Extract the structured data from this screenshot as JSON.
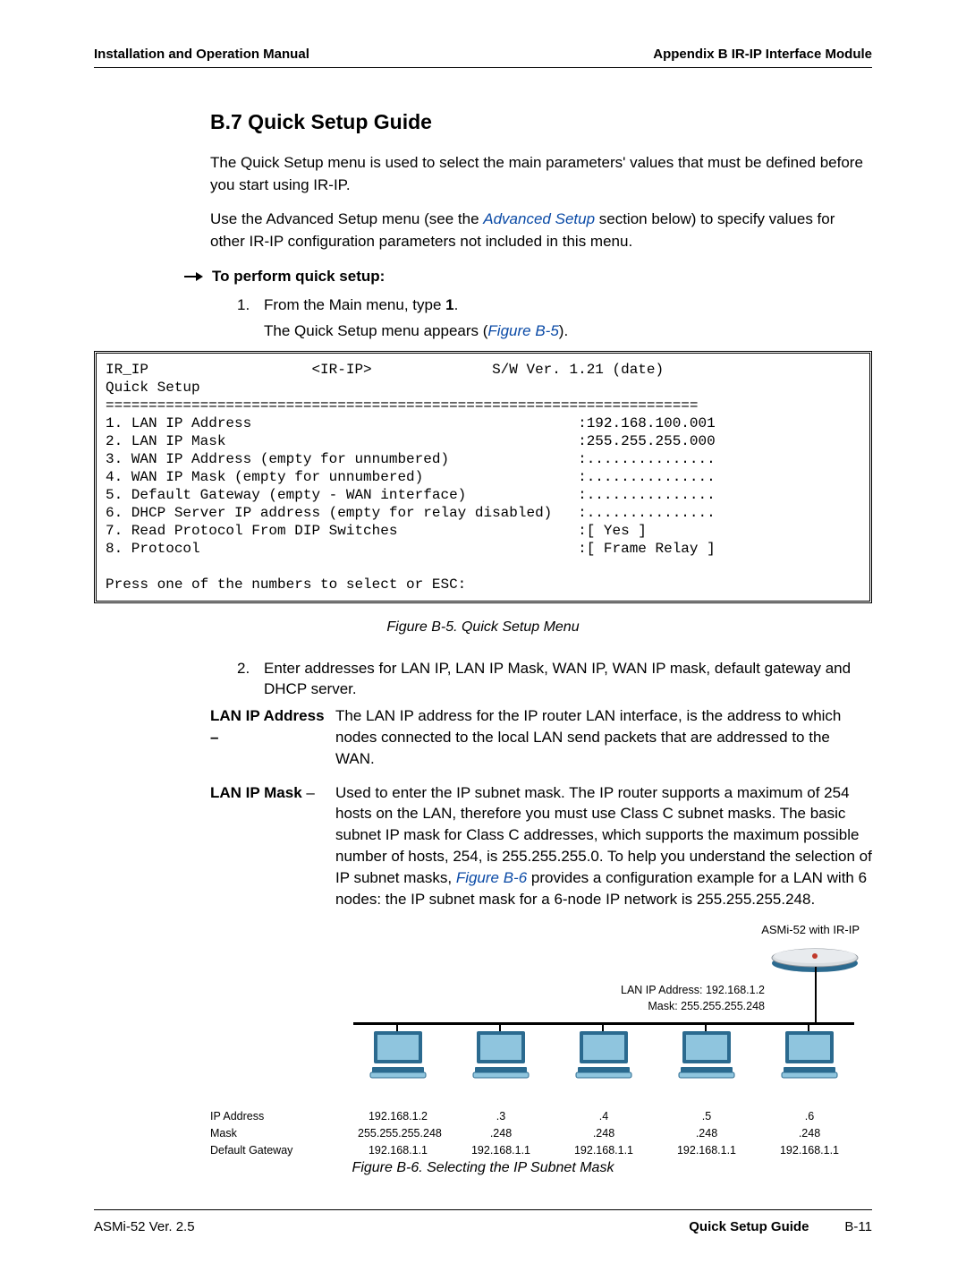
{
  "header": {
    "left": "Installation and Operation Manual",
    "right": "Appendix B  IR-IP Interface Module"
  },
  "section": {
    "title": "B.7  Quick Setup Guide",
    "p1": "The Quick Setup menu is used to select the main parameters' values that must be defined before you start using IR-IP.",
    "p2a": "Use the Advanced Setup menu (see the ",
    "p2link": "Advanced Setup",
    "p2b": " section below) to specify values for other IR-IP configuration parameters not included in this menu.",
    "task_label": "To perform quick setup:",
    "step1_num": "1.",
    "step1_text_a": "From the Main menu, type ",
    "step1_text_b": "1",
    "step1_text_c": ".",
    "step1_sub_a": "The Quick Setup menu appears (",
    "step1_sub_link": "Figure B-5",
    "step1_sub_b": ").",
    "step2_num": "2.",
    "step2_text": "Enter addresses for LAN IP, LAN IP Mask, WAN IP, WAN IP mask, default gateway and DHCP server.",
    "def1_term": "LAN IP Address –",
    "def1_text": "The LAN IP address for the IP router LAN interface, is the address to which nodes connected to the local LAN send packets that are addressed to the WAN.",
    "def2_term": "LAN IP Mask",
    "def2_dash": " –   ",
    "def2_text_a": "Used to enter the IP subnet mask. The IP router supports a maximum of 254 hosts on the LAN, therefore you must use Class C subnet masks. The basic subnet IP mask for Class C addresses, which supports the maximum possible number of hosts, 254, is 255.255.255.0. To help you understand the selection of IP subnet masks, ",
    "def2_link": "Figure B-6",
    "def2_text_b": " provides a configuration example for a LAN with 6 nodes: the IP subnet mask for a 6-node IP network is 255.255.255.248."
  },
  "terminal": "IR_IP                   <IR-IP>              S/W Ver. 1.21 (date)\nQuick Setup\n=====================================================================\n1. LAN IP Address                                      :192.168.100.001\n2. LAN IP Mask                                         :255.255.255.000\n3. WAN IP Address (empty for unnumbered)               :...............\n4. WAN IP Mask (empty for unnumbered)                  :...............\n5. Default Gateway (empty - WAN interface)             :...............\n6. DHCP Server IP address (empty for relay disabled)   :...............\n7. Read Protocol From DIP Switches                     :[ Yes ]\n8. Protocol                                            :[ Frame Relay ]\n\nPress one of the numbers to select or ESC:",
  "fig5_caption": "Figure B-5.  Quick Setup Menu",
  "fig6_caption": "Figure B-6.  Selecting the IP Subnet Mask",
  "chart_data": {
    "type": "diagram",
    "device_label": "ASMi-52 with IR-IP",
    "lan_label_1": "LAN IP Address: 192.168.1.2",
    "lan_label_2": "Mask: 255.255.255.248",
    "row_headers": [
      "IP Address",
      "Mask",
      "Default Gateway"
    ],
    "nodes": [
      {
        "ip": "192.168.1.2",
        "mask": "255.255.255.248",
        "gw": "192.168.1.1"
      },
      {
        "ip": ".3",
        "mask": ".248",
        "gw": "192.168.1.1"
      },
      {
        "ip": ".4",
        "mask": ".248",
        "gw": "192.168.1.1"
      },
      {
        "ip": ".5",
        "mask": ".248",
        "gw": "192.168.1.1"
      },
      {
        "ip": ".6",
        "mask": ".248",
        "gw": "192.168.1.1"
      }
    ]
  },
  "footer": {
    "left": "ASMi-52 Ver. 2.5",
    "section": "Quick Setup Guide",
    "page": "B-11"
  }
}
